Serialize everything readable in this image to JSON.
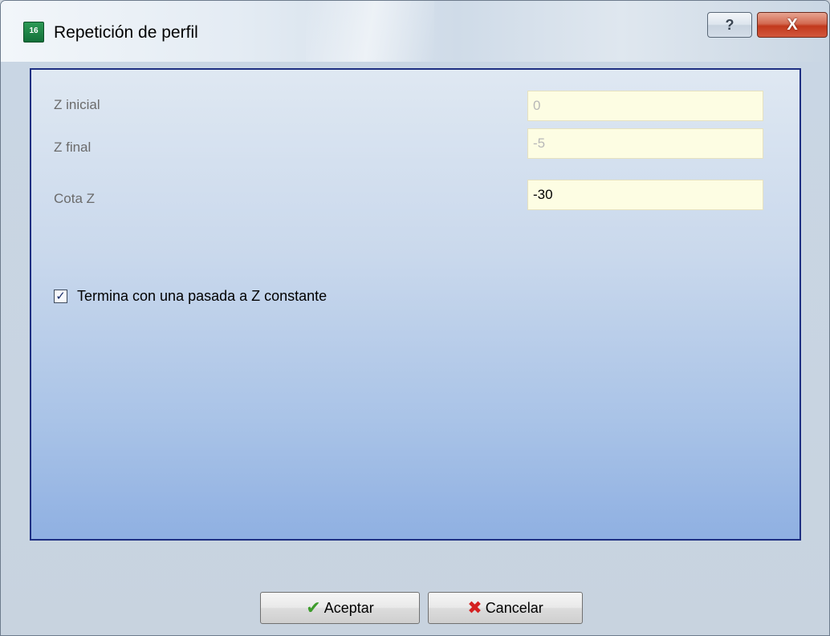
{
  "window": {
    "title": "Repetición de perfil",
    "icon": "app-icon",
    "icon_text": "16"
  },
  "title_controls": {
    "help_label": "?",
    "close_label": "X"
  },
  "form": {
    "z_inicial": {
      "label": "Z inicial",
      "value": "0",
      "disabled": true
    },
    "z_final": {
      "label": "Z final",
      "value": "-5",
      "disabled": true
    },
    "cota_z": {
      "label": "Cota Z",
      "value": "-30",
      "disabled": false
    },
    "checkbox": {
      "label": "Termina con una pasada a Z constante",
      "checked": true
    }
  },
  "buttons": {
    "ok_label": "Aceptar",
    "ok_icon": "check-icon",
    "cancel_label": "Cancelar",
    "cancel_icon": "x-icon"
  },
  "colors": {
    "field_background": "#fdfde3",
    "panel_border": "#1e2f82"
  }
}
